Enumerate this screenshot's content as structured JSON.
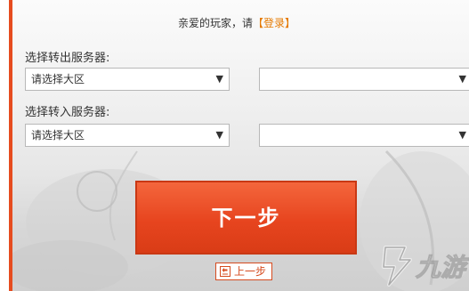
{
  "header": {
    "greeting_prefix": "亲爱的玩家，请",
    "login_label": "【登录】"
  },
  "transfer_out": {
    "label": "选择转出服务器:",
    "region_select": {
      "value": "请选择大区"
    },
    "server_select": {
      "value": ""
    }
  },
  "transfer_in": {
    "label": "选择转入服务器:",
    "region_select": {
      "value": "请选择大区"
    },
    "server_select": {
      "value": ""
    }
  },
  "actions": {
    "next_label": "下一步",
    "prev_label": "上一步"
  },
  "icons": {
    "dropdown": "triangle-down-icon",
    "back": "back-arrow-icon",
    "watermark": "jiuyou-logo-icon"
  },
  "watermark": {
    "text": "九游"
  },
  "colors": {
    "accent": "#e64c1f",
    "link": "#e57a00"
  }
}
